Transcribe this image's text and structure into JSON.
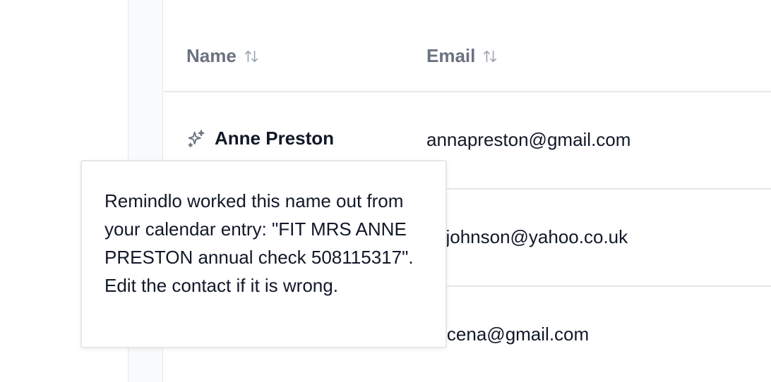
{
  "table": {
    "columns": [
      {
        "label": "Name",
        "sort_icon": "sort-arrows-icon"
      },
      {
        "label": "Email",
        "sort_icon": "sort-arrows-icon"
      }
    ],
    "rows": [
      {
        "name": "Anne Preston",
        "name_icon": "sparkle-icon",
        "email": "annapreston@gmail.com"
      },
      {
        "name": "",
        "email": "kejohnson@yahoo.co.uk"
      },
      {
        "name": "",
        "email": "nncena@gmail.com"
      }
    ]
  },
  "tooltip": {
    "text": "Remindlo worked this name out from your calendar entry: \"FIT MRS ANNE PRESTON annual check 508115317\". Edit the contact if it is wrong."
  }
}
